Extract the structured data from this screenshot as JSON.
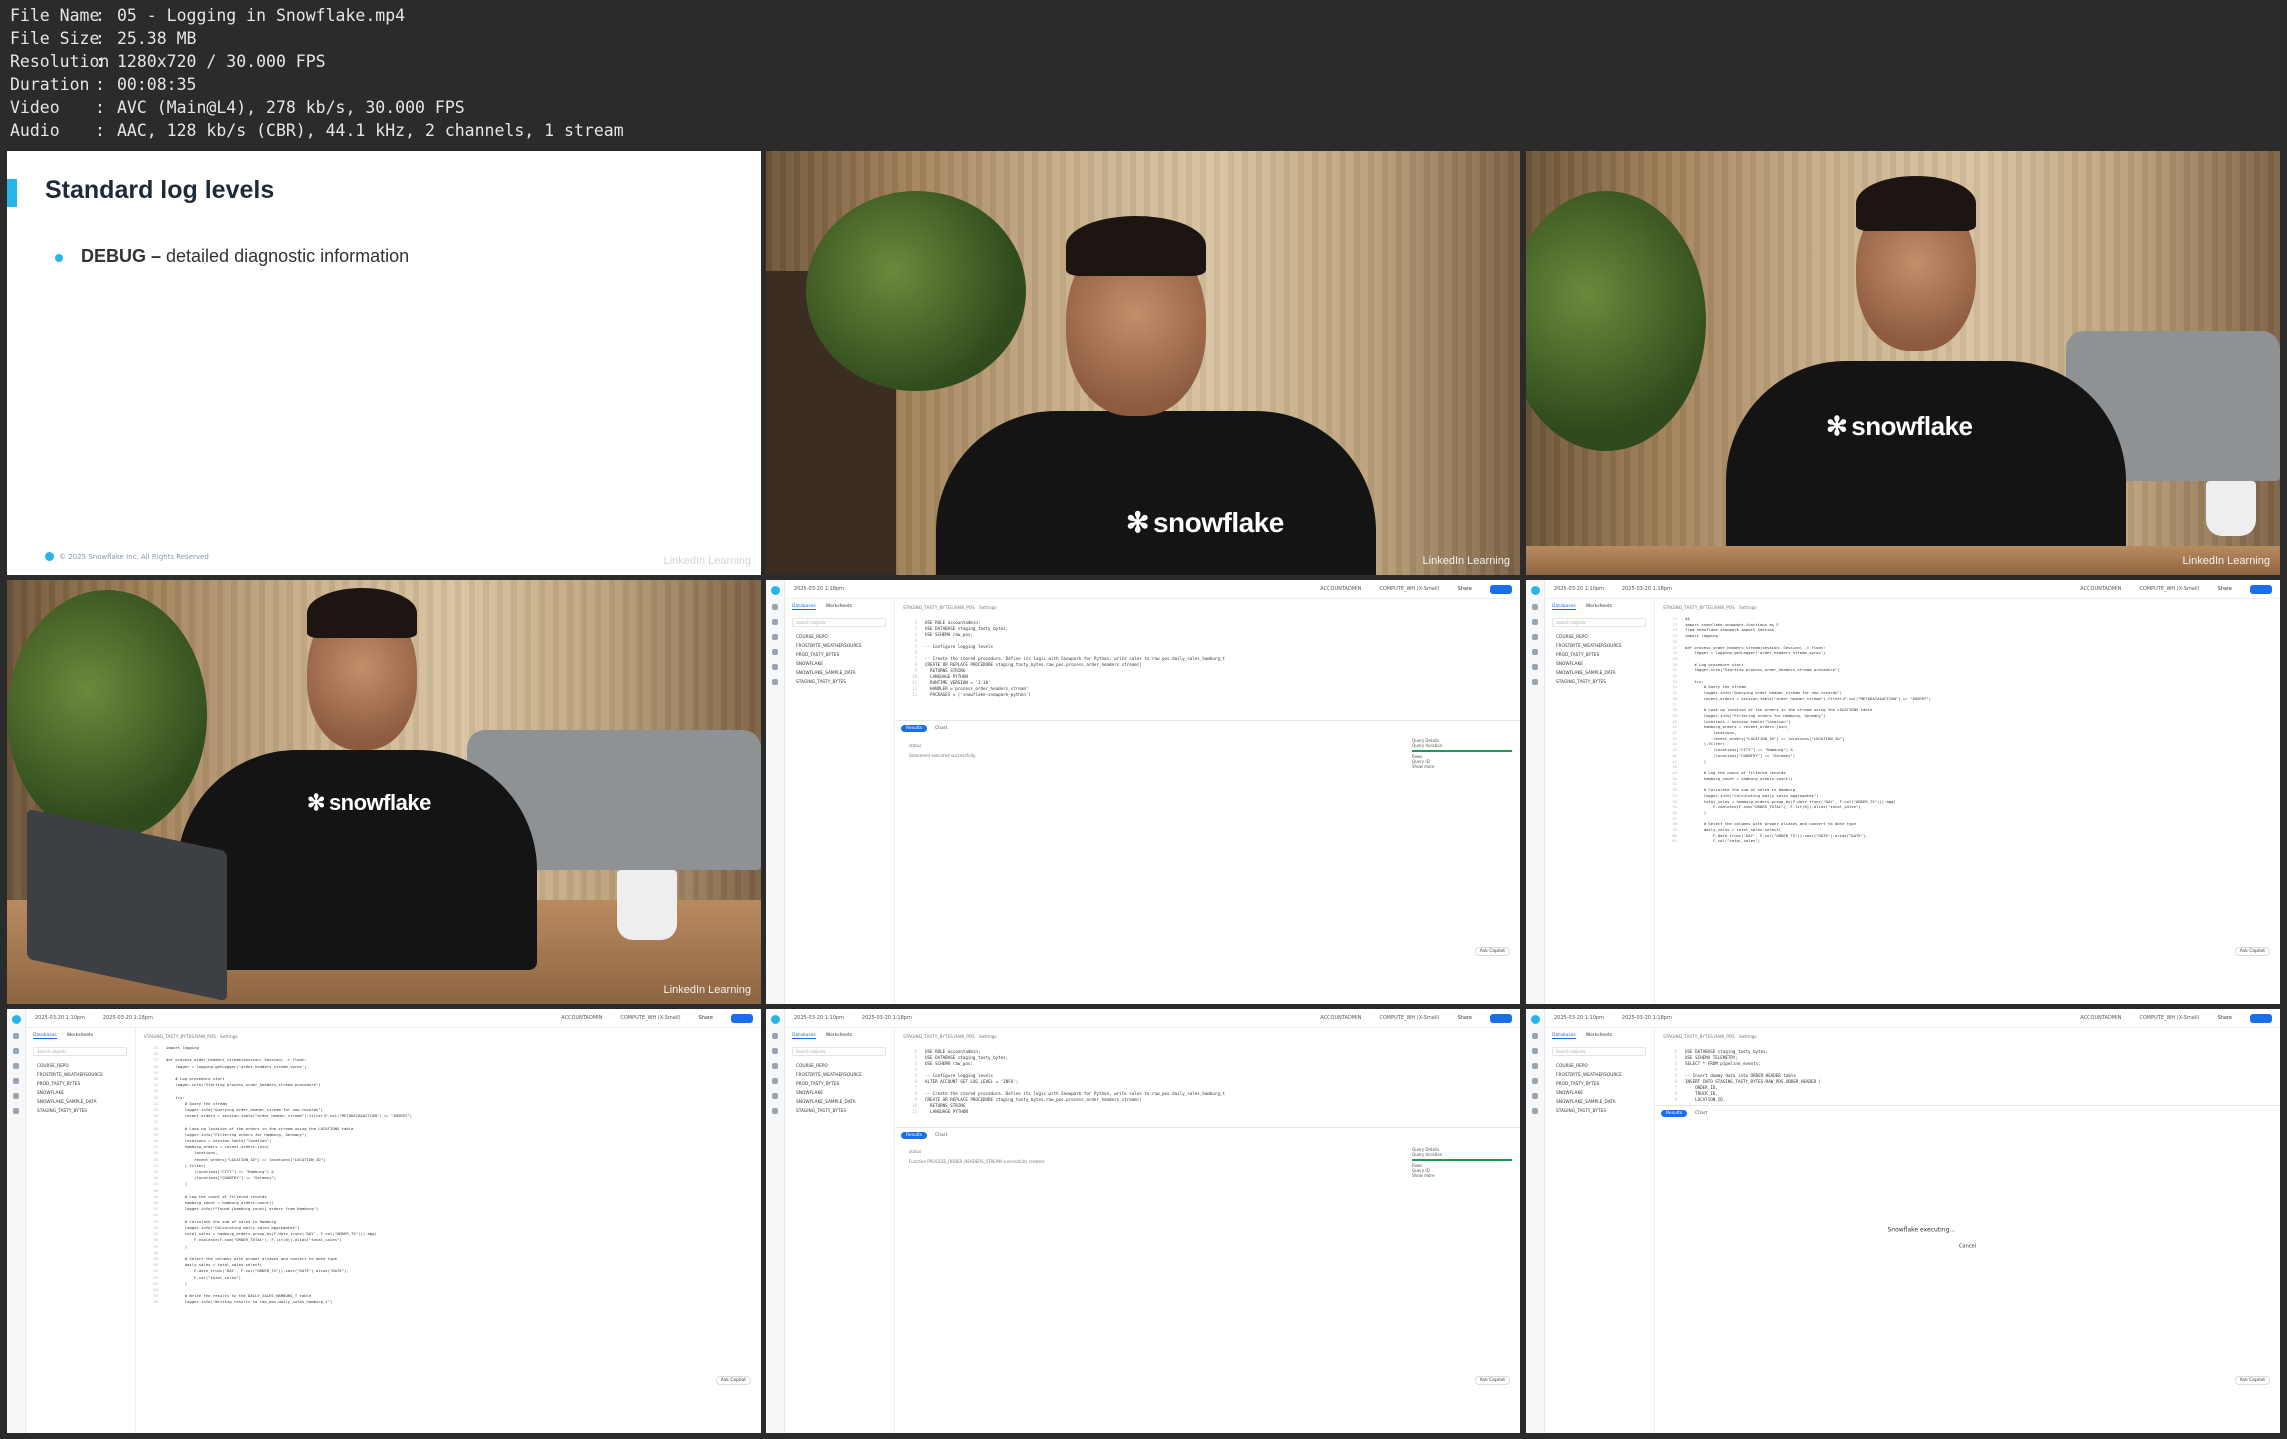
{
  "meta": [
    {
      "key": "File Name",
      "value": "05 - Logging in Snowflake.mp4"
    },
    {
      "key": "File Size",
      "value": "25.38 MB"
    },
    {
      "key": "Resolution",
      "value": "1280x720 / 30.000 FPS"
    },
    {
      "key": "Duration",
      "value": "00:08:35"
    },
    {
      "key": "Video",
      "value": "AVC (Main@L4), 278 kb/s, 30.000 FPS"
    },
    {
      "key": "Audio",
      "value": "AAC, 128 kb/s (CBR), 44.1 kHz, 2 channels, 1 stream"
    }
  ],
  "slide": {
    "title": "Standard log levels",
    "bullet_term": "DEBUG –",
    "bullet_text": " detailed diagnostic information",
    "footer": "© 2025 Snowflake Inc. All Rights Reserved"
  },
  "watermark": "LinkedIn Learning",
  "shirt_logo": "snowflake",
  "ui": {
    "tab_databases": "Databases",
    "tab_worksheets": "Worksheets",
    "search_placeholder": "Search objects",
    "databases": [
      "COURSE_REPO",
      "FROSTBYTE_WEATHERSOURCE",
      "PROD_TASTY_BYTES",
      "SNOWFLAKE",
      "SNOWFLAKE_SAMPLE_DATA",
      "STAGING_TASTY_BYTES"
    ],
    "tab_times": [
      "2025-03-20 1:10pm",
      "2025-03-20 1:18pm"
    ],
    "role": "ACCOUNTADMIN",
    "warehouse": "COMPUTE_WH (X-Small)",
    "share": "Share",
    "crumb_db": "STAGING_TASTY_BYTES.RAW_POS",
    "crumb_settings": "Settings",
    "results": "Results",
    "chart": "Chart",
    "status_col": "status",
    "status_success": "Statement executed successfully.",
    "status_created": "Function PROCESS_ORDER_HEADERS_STREAM successfully created.",
    "query_details": "Query Details",
    "query_duration": "Query duration",
    "rows": "Rows",
    "query_id": "Query ID",
    "show_more": "Show more",
    "ask_copilot": "Ask Copilot",
    "executing": "Snowflake executing...",
    "cancel": "Cancel",
    "code_a": [
      "USE ROLE accountadmin;",
      "USE DATABASE staging_tasty_bytes;",
      "USE SCHEMA raw_pos;",
      "",
      "-- Configure logging levels",
      "",
      "-- Create the stored procedure. Define its logic with Snowpark for Python, write sales to raw_pos.daily_sales_hamburg_t",
      "CREATE OR REPLACE PROCEDURE staging_tasty_bytes.raw_pos.process_order_headers_stream()",
      "  RETURNS STRING",
      "  LANGUAGE PYTHON",
      "  RUNTIME_VERSION = '3.10'",
      "  HANDLER ='process_order_headers_stream'",
      "  PACKAGES = ('snowflake-snowpark-python')"
    ],
    "code_b": [
      "$$",
      "import snowflake.snowpark.functions as F",
      "from snowflake.snowpark import Session",
      "import logging",
      "",
      "def process_order_headers_stream(session: Session) -> float:",
      "    logger = logging.getLogger('order_headers_stream_sproc')",
      "",
      "    # Log procedure start",
      "    logger.info(\"Starting process_order_headers_stream procedure\")",
      "",
      "    try:",
      "        # Query the stream",
      "        logger.info(\"Querying order_header_stream for new records\")",
      "        recent_orders = session.table(\"order_header_stream\").filter(F.col(\"METADATA$ACTION\") == \"INSERT\")",
      "",
      "        # Look up location of the orders in the stream using the LOCATIONS table",
      "        logger.info(\"Filtering orders for Hamburg, Germany\")",
      "        locations = session.table(\"location\")",
      "        hamburg_orders = recent_orders.join(",
      "            locations,",
      "            recent_orders[\"LOCATION_ID\"] == locations[\"LOCATION_ID\"]",
      "        ).filter(",
      "            (locations[\"CITY\"] == \"Hamburg\") &",
      "            (locations[\"COUNTRY\"] == \"Germany\")",
      "        )",
      "",
      "        # Log the count of filtered records",
      "        hamburg_count = hamburg_orders.count()",
      "",
      "        # Calculate the sum of sales in Hamburg",
      "        logger.info(\"Calculating daily sales aggregates\")",
      "        total_sales = hamburg_orders.group_by(F.date_trunc('DAY', F.col(\"ORDER_TS\"))).agg(",
      "            F.coalesce(F.sum(\"ORDER_TOTAL\"), F.lit(0)).alias(\"total_sales\")",
      "        )",
      "",
      "        # Select the columns with proper aliases and convert to date type",
      "        daily_sales = total_sales.select(",
      "            F.date_trunc('DAY', F.col(\"ORDER_TS\")).cast(\"DATE\").alias(\"DATE\"),",
      "            F.col(\"total_sales\")"
    ],
    "code_c": [
      "import logging",
      "",
      "def process_order_headers_stream(session: Session) -> float:",
      "    logger = logging.getLogger('order_headers_stream_sproc')",
      "",
      "    # Log procedure start",
      "    logger.info(\"Starting process_order_headers_stream procedure\")",
      "",
      "    try:",
      "        # Query the stream",
      "        logger.info(\"Querying order_header_stream for new records\")",
      "        recent_orders = session.table(\"order_header_stream\").filter(F.col(\"METADATA$ACTION\") == \"INSERT\")",
      "",
      "        # Look up location of the orders in the stream using the LOCATIONS table",
      "        logger.info(\"Filtering orders for Hamburg, Germany\")",
      "        locations = session.table(\"location\")",
      "        hamburg_orders = recent_orders.join(",
      "            locations,",
      "            recent_orders[\"LOCATION_ID\"] == locations[\"LOCATION_ID\"]",
      "        ).filter(",
      "            (locations[\"CITY\"] == \"Hamburg\") &",
      "            (locations[\"COUNTRY\"] == \"Germany\")",
      "        )",
      "",
      "        # Log the count of filtered records",
      "        hamburg_count = hamburg_orders.count()",
      "        logger.info(f\"Found {hamburg_count} orders from Hamburg\")",
      "",
      "        # Calculate the sum of sales in Hamburg",
      "        logger.info(\"Calculating daily sales aggregates\")",
      "        total_sales = hamburg_orders.group_by(F.date_trunc('DAY', F.col(\"ORDER_TS\"))).agg(",
      "            F.coalesce(F.sum(\"ORDER_TOTAL\"), F.lit(0)).alias(\"total_sales\")",
      "        )",
      "",
      "        # Select the columns with proper aliases and convert to date type",
      "        daily_sales = total_sales.select(",
      "            F.date_trunc('DAY', F.col(\"ORDER_TS\")).cast(\"DATE\").alias(\"DATE\"),",
      "            F.col(\"total_sales\")",
      "        )",
      "",
      "        # Write the results to the DAILY_SALES_HAMBURG_T table",
      "        logger.info(\"Writing results to raw_pos.daily_sales_hamburg_t\")"
    ],
    "code_d": [
      "USE ROLE accountadmin;",
      "USE DATABASE staging_tasty_bytes;",
      "USE SCHEMA raw_pos;",
      "",
      "-- Configure logging levels",
      "ALTER ACCOUNT SET LOG_LEVEL = 'INFO';",
      "",
      "-- Create the stored procedure. Define its logic with Snowpark for Python, write sales to raw_pos.daily_sales_hamburg_t",
      "CREATE OR REPLACE PROCEDURE staging_tasty_bytes.raw_pos.process_order_headers_stream()",
      "  RETURNS STRING",
      "  LANGUAGE PYTHON"
    ],
    "code_e": [
      "USE DATABASE staging_tasty_bytes;",
      "USE SCHEMA TELEMETRY;",
      "SELECT * FROM pipeline_events;",
      "",
      "-- Insert dummy data into ORDER_HEADER table",
      "INSERT INTO STAGING_TASTY_BYTES.RAW_POS.ORDER_HEADER (",
      "    ORDER_ID,",
      "    TRUCK_ID,",
      "    LOCATION_ID,"
    ]
  }
}
